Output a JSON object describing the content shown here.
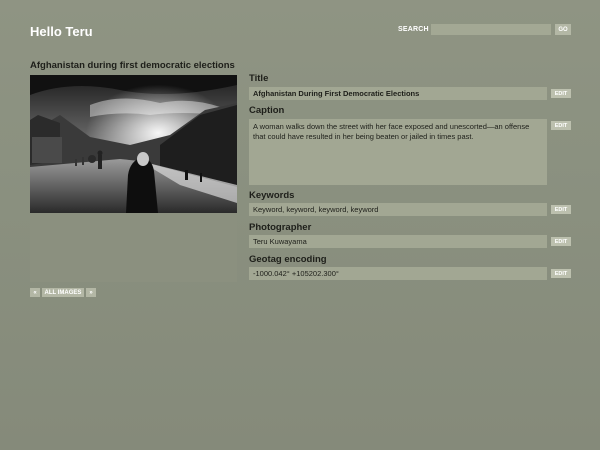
{
  "header": {
    "title": "Hello Teru",
    "search_label": "SEARCH",
    "search_value": "",
    "search_placeholder": "",
    "go_label": "GO"
  },
  "image": {
    "title": "Afghanistan during first democratic elections"
  },
  "pager": {
    "prev_label": "«",
    "all_label": "ALL IMAGES",
    "next_label": "»"
  },
  "fields": {
    "title": {
      "label": "Title",
      "value": "Afghanistan During First Democratic Elections",
      "edit": "EDIT"
    },
    "caption": {
      "label": "Caption",
      "value": "A woman walks down the street with her face exposed and unescorted—an offense that could have resulted in her being beaten or jailed in times past.",
      "edit": "EDIT"
    },
    "keywords": {
      "label": "Keywords",
      "value": "Keyword, keyword, keyword, keyword",
      "edit": "EDIT"
    },
    "photographer": {
      "label": "Photographer",
      "value": "Teru Kuwayama",
      "edit": "EDIT"
    },
    "geotag": {
      "label": "Geotag encoding",
      "value": "-1000.042° +105202.300°",
      "edit": "EDIT"
    }
  },
  "colors": {
    "background": "#8b9180",
    "field_bg": "#a2a793",
    "button_bg": "#bcc0ae",
    "label_text": "#1e1f1a"
  }
}
